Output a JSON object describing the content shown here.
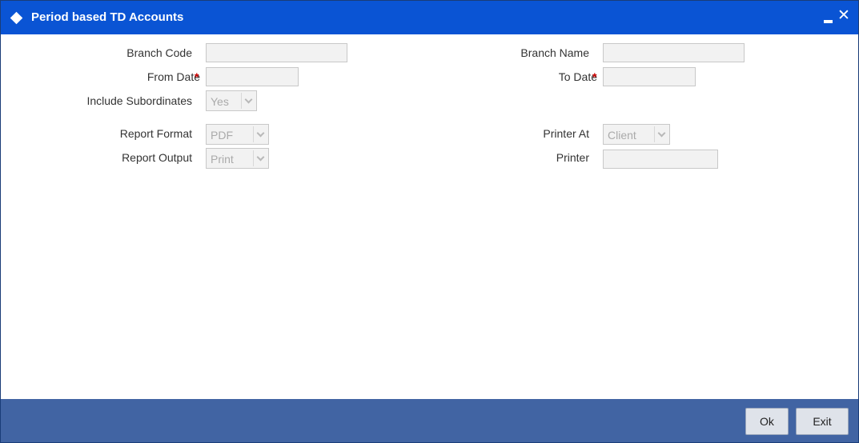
{
  "window": {
    "title": "Period based TD Accounts"
  },
  "icons": {
    "title": "diamond-icon",
    "minimize": "minimize-icon",
    "close": "close-icon"
  },
  "window_controls": {
    "close": "✕"
  },
  "form": {
    "branch_code_label": "Branch Code",
    "branch_code_value": "",
    "branch_name_label": "Branch Name",
    "branch_name_value": "",
    "from_date_label": "From Date",
    "from_date_value": "",
    "to_date_label": "To Date",
    "to_date_value": "",
    "required_marker": "*",
    "include_subordinates_label": "Include Subordinates",
    "include_subordinates_value": "Yes",
    "report_format_label": "Report Format",
    "report_format_value": "PDF",
    "report_output_label": "Report Output",
    "report_output_value": "Print",
    "printer_at_label": "Printer At",
    "printer_at_value": "Client",
    "printer_label": "Printer",
    "printer_value": ""
  },
  "footer": {
    "ok_label": "Ok",
    "exit_label": "Exit"
  },
  "colors": {
    "titlebar": "#0a54d4",
    "footer": "#4164a3",
    "required": "#cc0000",
    "field_bg": "#f2f2f2"
  }
}
